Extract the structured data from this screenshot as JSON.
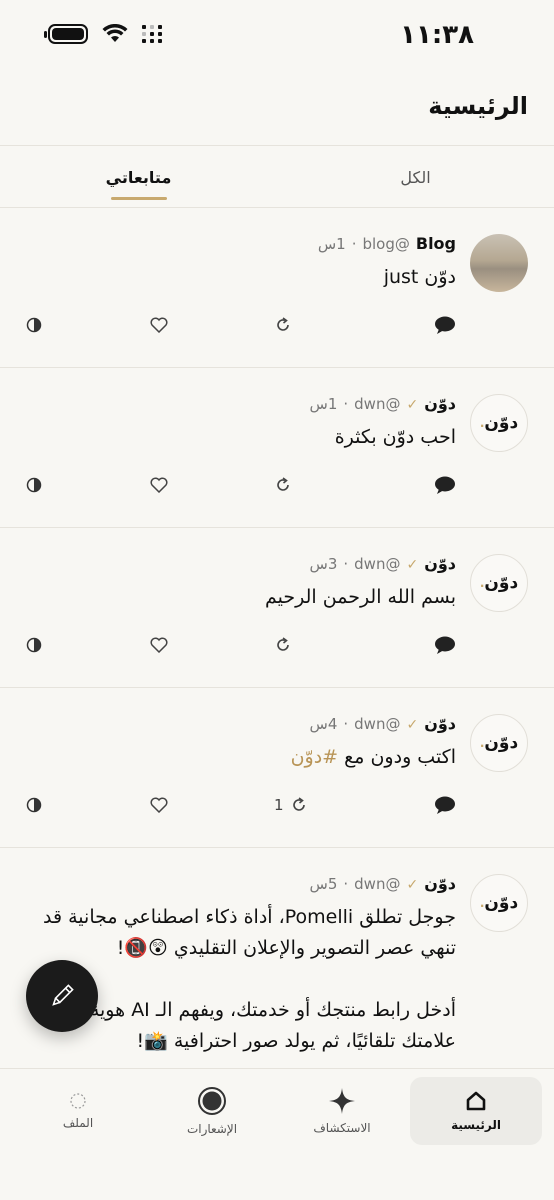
{
  "status_bar": {
    "time": "١١:٣٨"
  },
  "header": {
    "title": "الرئيسية"
  },
  "tabs": [
    {
      "label": "الكل",
      "active": false
    },
    {
      "label": "متابعاتي",
      "active": true
    }
  ],
  "posts": [
    {
      "author": "Blog",
      "handle": "@blog",
      "time": "1س",
      "verified": false,
      "avatar": "photo",
      "text": "دوّن just",
      "repost_count": ""
    },
    {
      "author": "دوّن",
      "handle": "@dwn",
      "time": "1س",
      "verified": true,
      "avatar": "دوّن",
      "text": "احب دوّن بكثرة",
      "repost_count": ""
    },
    {
      "author": "دوّن",
      "handle": "@dwn",
      "time": "3س",
      "verified": true,
      "avatar": "دوّن",
      "text": "بسم الله الرحمن الرحيم",
      "repost_count": ""
    },
    {
      "author": "دوّن",
      "handle": "@dwn",
      "time": "4س",
      "verified": true,
      "avatar": "دوّن",
      "text": "اكتب ودون مع ",
      "hashtag": "#دوّن",
      "repost_count": "1"
    },
    {
      "author": "دوّن",
      "handle": "@dwn",
      "time": "5س",
      "verified": true,
      "avatar": "دوّن",
      "text_lines": [
        "جوجل تطلق Pomelli، أداة ذكاء اصطناعي مجانية قد",
        "تنهي عصر التصوير والإعلان التقليدي 😲📵!",
        "",
        "أدخل رابط منتجك أو خدمتك، ويفهم الـ AI هوية",
        "علامتك تلقائيًا، ثم يولد صور احترافية 📸!"
      ]
    }
  ],
  "bottom_nav": [
    {
      "label": "الرئيسية",
      "icon": "home-icon",
      "active": true
    },
    {
      "label": "الاستكشاف",
      "icon": "sparkle-icon",
      "active": false
    },
    {
      "label": "الإشعارات",
      "icon": "notifications-icon",
      "active": false
    },
    {
      "label": "الملف",
      "icon": "profile-icon",
      "active": false
    }
  ],
  "colors": {
    "accent": "#c8a96e",
    "background": "#f8f7f3",
    "fab": "#1b1b1b"
  }
}
